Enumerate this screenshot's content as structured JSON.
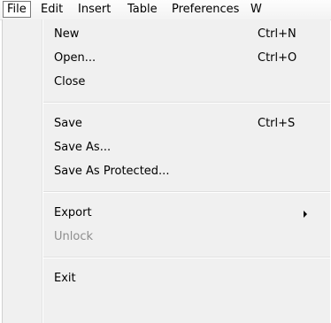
{
  "menubar": {
    "items": [
      {
        "label": "File"
      },
      {
        "label": "Edit"
      },
      {
        "label": "Insert"
      },
      {
        "label": "Table"
      },
      {
        "label": "Preferences"
      },
      {
        "label": "W"
      }
    ]
  },
  "file_menu": {
    "new": {
      "label": "New",
      "shortcut": "Ctrl+N"
    },
    "open": {
      "label": "Open...",
      "shortcut": "Ctrl+O"
    },
    "close": {
      "label": "Close"
    },
    "save": {
      "label": "Save",
      "shortcut": "Ctrl+S"
    },
    "save_as": {
      "label": "Save As..."
    },
    "save_as_protected": {
      "label": "Save As Protected..."
    },
    "export": {
      "label": "Export"
    },
    "unlock": {
      "label": "Unlock",
      "disabled": true
    },
    "exit": {
      "label": "Exit"
    }
  }
}
